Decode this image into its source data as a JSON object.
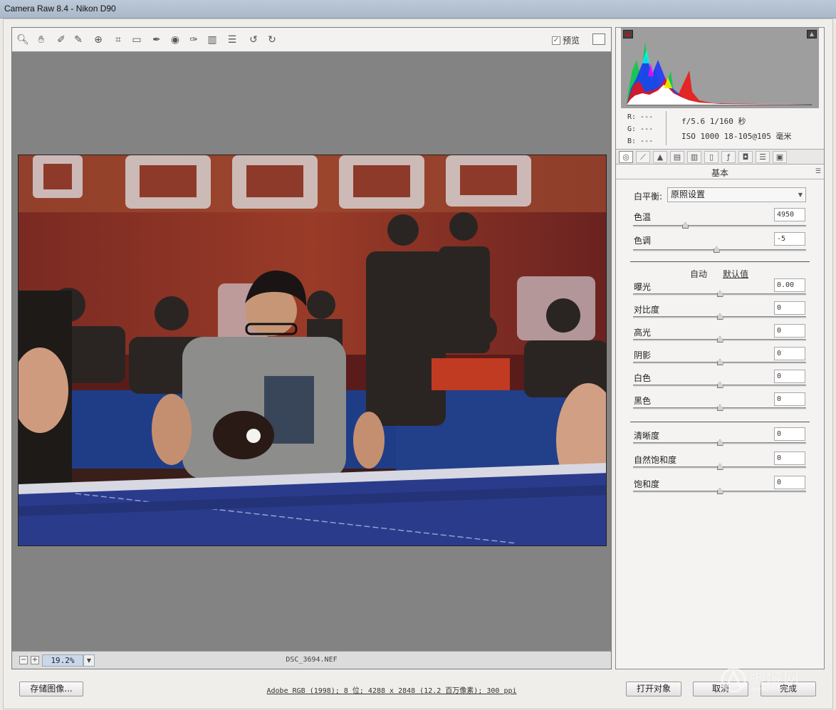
{
  "window": {
    "title": "Camera Raw 8.4 -  Nikon D90"
  },
  "toolbar": {
    "tools": [
      "zoom-icon",
      "hand-icon",
      "white-balance-icon",
      "color-sampler-icon",
      "targeted-adjustment-icon",
      "crop-icon",
      "straighten-icon",
      "spot-removal-icon",
      "red-eye-icon",
      "adjustment-brush-icon",
      "graduated-filter-icon",
      "radial-filter-icon",
      "preferences-icon",
      "rotate-ccw-icon",
      "rotate-cw-icon"
    ],
    "preview_label": "预览",
    "preview_checked": true
  },
  "statusbar": {
    "zoom": "19.2%",
    "filename": "DSC_3694.NEF"
  },
  "histogram": {
    "readout": {
      "r": "R: ---",
      "g": "G: ---",
      "b": "B: ---"
    }
  },
  "exif": {
    "line1": "f/5.6  1/160 秒",
    "line2": "ISO 1000  18-105@105 毫米"
  },
  "panel": {
    "tabs": [
      "basic-icon",
      "tone-curve-icon",
      "detail-icon",
      "hsl-icon",
      "split-toning-icon",
      "lens-icon",
      "fx-icon",
      "camera-calibration-icon",
      "presets-icon",
      "snapshots-icon"
    ],
    "section_title": "基本",
    "white_balance": {
      "label": "白平衡:",
      "value": "原照设置"
    },
    "temp": {
      "label": "色温",
      "value": "4950",
      "level": 0.3
    },
    "tint": {
      "label": "色调",
      "value": "-5",
      "level": 0.48
    },
    "auto_label": "自动",
    "default_label": "默认值",
    "tone": [
      {
        "label": "曝光",
        "value": "0.00",
        "level": 0.5
      },
      {
        "label": "对比度",
        "value": "0",
        "level": 0.5
      },
      {
        "label": "高光",
        "value": "0",
        "level": 0.5
      },
      {
        "label": "阴影",
        "value": "0",
        "level": 0.5
      },
      {
        "label": "白色",
        "value": "0",
        "level": 0.5
      },
      {
        "label": "黑色",
        "value": "0",
        "level": 0.5
      }
    ],
    "presence": [
      {
        "label": "清晰度",
        "value": "0",
        "level": 0.5
      },
      {
        "label": "自然饱和度",
        "value": "0",
        "level": 0.5
      },
      {
        "label": "饱和度",
        "value": "0",
        "level": 0.5
      }
    ]
  },
  "bottom": {
    "save_label": "存储图像...",
    "workflow": "Adobe RGB (1998); 8 位; 4288 x 2848 (12.2 百万像素); 300 ppi",
    "open_label": "打开对象",
    "cancel_label": "取消",
    "done_label": "完成",
    "watermark": "脚城网",
    "watermark_url": "www.jb51.net"
  }
}
